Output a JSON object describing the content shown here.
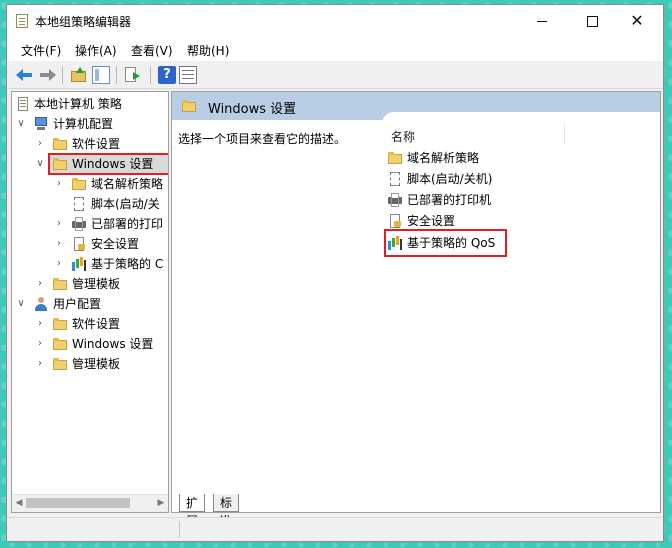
{
  "window": {
    "title": "本地组策略编辑器"
  },
  "menu": [
    {
      "label": "文件(F)"
    },
    {
      "label": "操作(A)"
    },
    {
      "label": "查看(V)"
    },
    {
      "label": "帮助(H)"
    }
  ],
  "toolbar": {
    "help_glyph": "?"
  },
  "tree": {
    "root": "本地计算机 策略",
    "computer_config": "计算机配置",
    "cc_software": "软件设置",
    "cc_windows": "Windows 设置",
    "cc_win_dns": "域名解析策略",
    "cc_win_scripts": "脚本(启动/关",
    "cc_win_printers": "已部署的打印",
    "cc_win_security": "安全设置",
    "cc_win_qos": "基于策略的 C",
    "cc_admin": "管理模板",
    "user_config": "用户配置",
    "uc_software": "软件设置",
    "uc_windows": "Windows 设置",
    "uc_admin": "管理模板"
  },
  "detail": {
    "header": "Windows 设置",
    "description": "选择一个项目来查看它的描述。",
    "column_name": "名称",
    "items": [
      {
        "label": "域名解析策略",
        "icon": "folder-icon"
      },
      {
        "label": "脚本(启动/关机)",
        "icon": "script-icon"
      },
      {
        "label": "已部署的打印机",
        "icon": "printer-icon"
      },
      {
        "label": "安全设置",
        "icon": "security-icon"
      },
      {
        "label": "基于策略的 QoS",
        "icon": "qos-chart-icon"
      }
    ]
  },
  "tabs": {
    "extended": "扩展",
    "standard": "标准"
  },
  "colors": {
    "header_bg": "#b9cde5",
    "highlight": "#e02020",
    "selection_bg": "#d9d9d9"
  }
}
